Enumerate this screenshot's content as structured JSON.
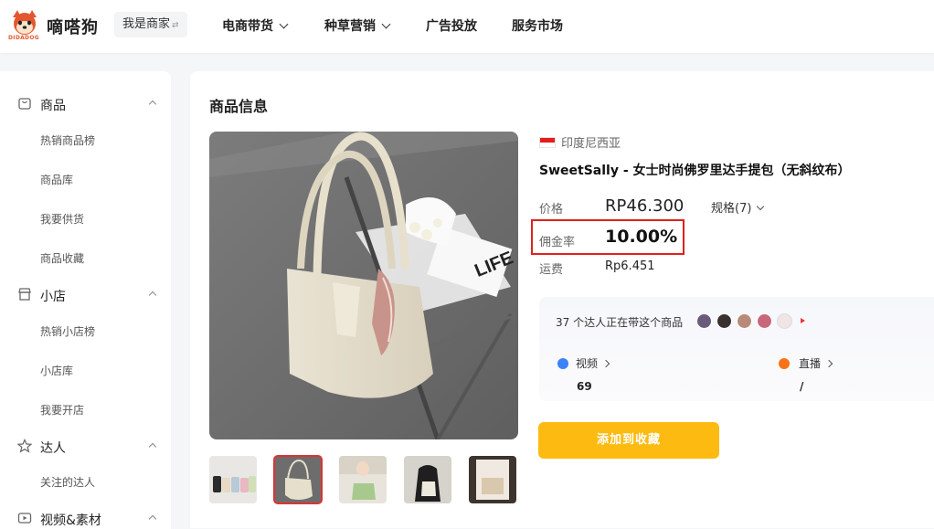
{
  "header": {
    "logo_text": "DIDADOG",
    "brand": "嘀嗒狗",
    "merchant_button": "我是商家",
    "nav": [
      {
        "label": "电商带货",
        "has_dropdown": true
      },
      {
        "label": "种草营销",
        "has_dropdown": true
      },
      {
        "label": "广告投放",
        "has_dropdown": false
      },
      {
        "label": "服务市场",
        "has_dropdown": false
      }
    ]
  },
  "sidebar": {
    "groups": [
      {
        "label": "商品",
        "icon": "bag-icon",
        "items": [
          "热销商品榜",
          "商品库",
          "我要供货",
          "商品收藏"
        ]
      },
      {
        "label": "小店",
        "icon": "store-icon",
        "items": [
          "热销小店榜",
          "小店库",
          "我要开店"
        ]
      },
      {
        "label": "达人",
        "icon": "star-icon",
        "items": [
          "关注的达人"
        ]
      },
      {
        "label": "视频&素材",
        "icon": "video-icon",
        "items": []
      }
    ]
  },
  "main": {
    "section_title": "商品信息",
    "country": "印度尼西亚",
    "product_name": "SweetSally - 女士时尚佛罗里达手提包（无斜纹布）",
    "price_label": "价格",
    "price": "RP46.300",
    "spec_label": "规格(7)",
    "commission_label": "佣金率",
    "commission": "10.00%",
    "shipping_label": "运费",
    "shipping": "Rp6.451",
    "creators_text": "37 个达人正在带这个商品",
    "stats": [
      {
        "label": "视频",
        "value": "69",
        "icon": "video-dot-icon",
        "color": "#3b82f6"
      },
      {
        "label": "直播",
        "value": "/",
        "icon": "live-dot-icon",
        "color": "#f97316"
      }
    ],
    "add_favorite_button": "添加到收藏",
    "thumbnails": 5,
    "active_thumbnail": 2
  },
  "colors": {
    "accent": "#fdbb12",
    "highlight_border": "#e02020",
    "brand": "#e4572e"
  }
}
